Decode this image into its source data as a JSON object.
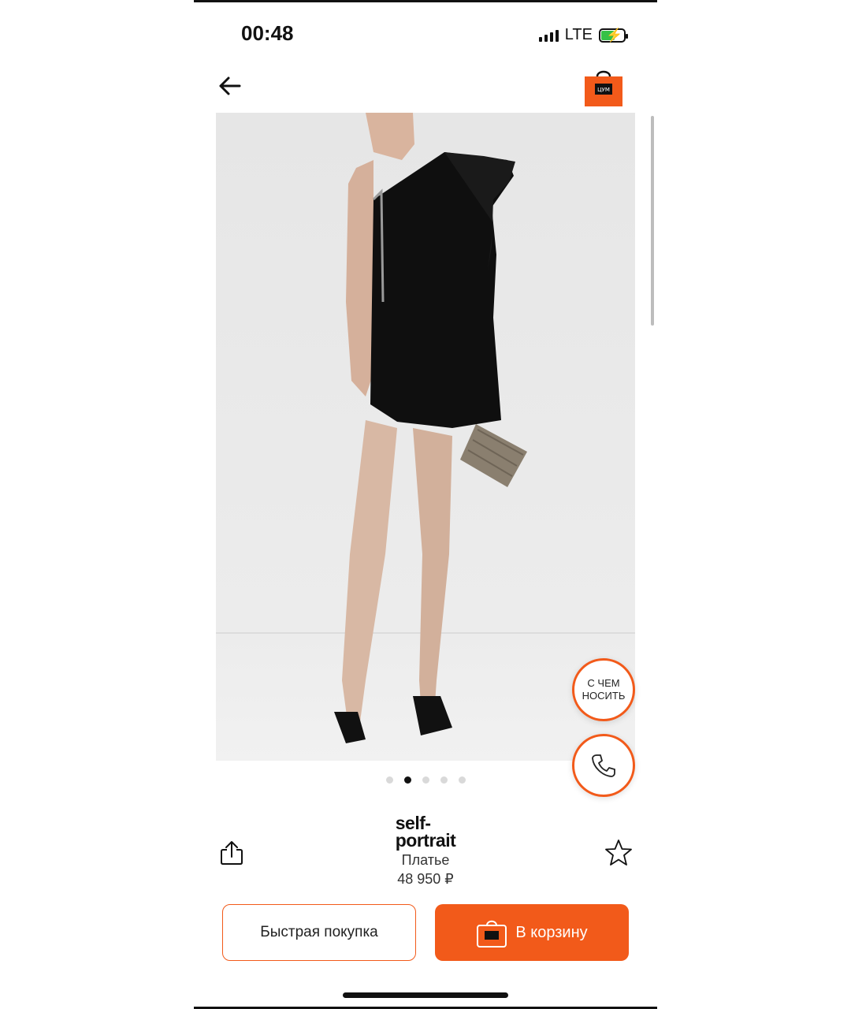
{
  "status_bar": {
    "time": "00:48",
    "network": "LTE"
  },
  "header": {
    "back_icon": "arrow-left-icon",
    "cart_icon": "shopping-bag-icon",
    "cart_logo_text": "ЦУМ"
  },
  "gallery": {
    "image_description_icon": "product-photo",
    "dots_total": 5,
    "active_index": 1
  },
  "fabs": {
    "what_to_wear_label": "С ЧЕМ НОСИТЬ",
    "call_icon": "phone-icon"
  },
  "product": {
    "brand_line1": "self-",
    "brand_line2": "portrait",
    "name": "Платье",
    "price": "48 950 ₽"
  },
  "actions": {
    "share_icon": "share-icon",
    "favorite_icon": "star-icon",
    "quick_buy_label": "Быстрая покупка",
    "add_to_cart_label": "В корзину"
  },
  "colors": {
    "accent": "#f25a1a"
  }
}
